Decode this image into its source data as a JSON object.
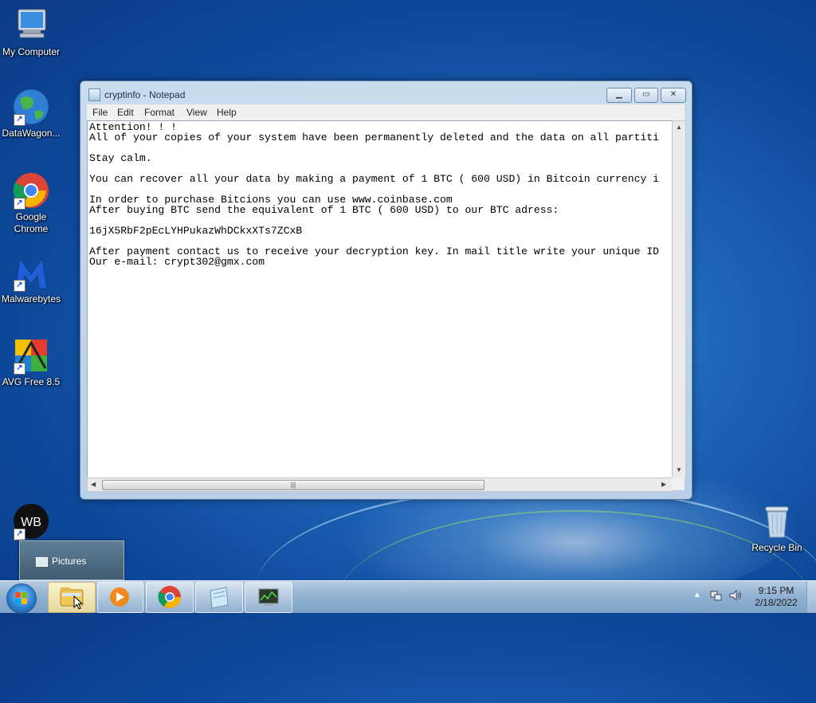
{
  "desktop": {
    "icons": [
      {
        "label": "My Computer"
      },
      {
        "label": "DataWagon..."
      },
      {
        "label": "Google Chrome"
      },
      {
        "label": "Malwarebytes"
      },
      {
        "label": "AVG Free 8.5"
      },
      {
        "label": "WB"
      },
      {
        "label": "Recycle Bin"
      }
    ]
  },
  "notepad": {
    "title": "cryptinfo - Notepad",
    "menu": [
      "File",
      "Edit",
      "Format",
      "View",
      "Help"
    ],
    "lines": [
      "Attention! ! !",
      "All of your copies of your system have been permanently deleted and the data on all partiti",
      "",
      "Stay calm.",
      "",
      "You can recover all your data by making a payment of 1 BTC ( 600 USD) in Bitcoin currency i",
      "",
      "In order to purchase Bitcions you can use www.coinbase.com",
      "After buying BTC send the equivalent of 1 BTC ( 600 USD) to our BTC adress:",
      "",
      "16jX5RbF2pEcLYHPukazWhDCkxXTs7ZCxB",
      "",
      "After payment contact us to receive your decryption key. In mail title write your unique ID",
      "Our e-mail: crypt302@gmx.com"
    ]
  },
  "popup": {
    "label": "Pictures"
  },
  "taskbar": {
    "items": [
      "Windows Explorer",
      "Windows Media Player",
      "Google Chrome",
      "Notepad",
      "Task Manager"
    ],
    "clock": {
      "time": "9:15 PM",
      "date": "2/18/2022"
    }
  }
}
